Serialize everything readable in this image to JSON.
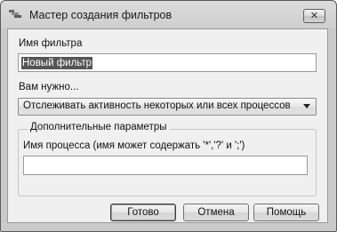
{
  "window": {
    "title": "Мастер создания фильтров",
    "close_label": "✕"
  },
  "form": {
    "filter_name_label": "Имя фильтра",
    "filter_name_value": "Новый фильтр",
    "need_label": "Вам нужно...",
    "need_selected": "Отслеживать активность некоторых или всех процессов",
    "advanced_group_title": "Дополнительные параметры",
    "process_name_label": "Имя процесса (имя может содержать '*','?' и ';')",
    "process_name_value": ""
  },
  "buttons": {
    "ok": "Готово",
    "cancel": "Отмена",
    "help": "Помощь"
  },
  "icons": {
    "title_icon": "filter-wizard-icon",
    "dropdown": "chevron-down-icon",
    "close": "close-icon"
  }
}
